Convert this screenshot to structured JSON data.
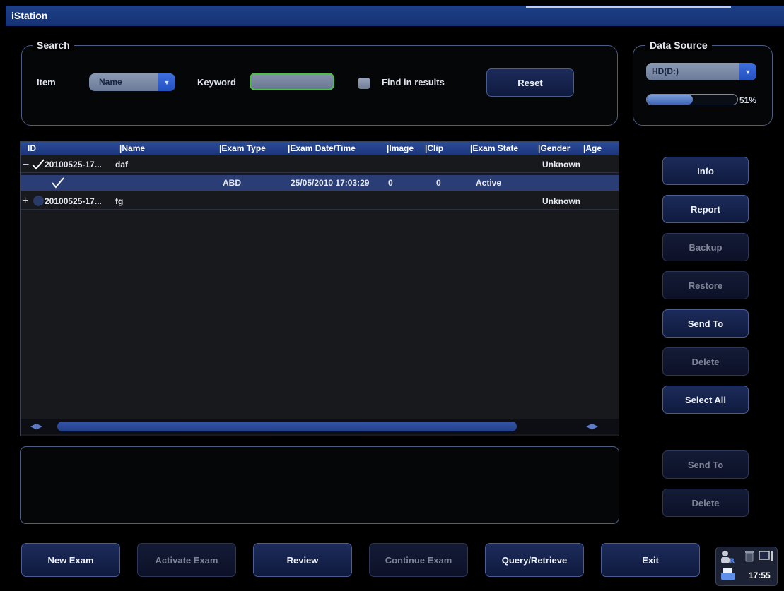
{
  "window": {
    "title": "iStation"
  },
  "search": {
    "group_label": "Search",
    "item_label": "Item",
    "item_value": "Name",
    "keyword_label": "Keyword",
    "keyword_value": "",
    "find_in_results_label": "Find in results",
    "find_in_results_checked": false,
    "reset_label": "Reset"
  },
  "data_source": {
    "group_label": "Data Source",
    "drive": "HD(D:)",
    "usage_percent": 51,
    "usage_text": "51%"
  },
  "table": {
    "columns": [
      "ID",
      "Name",
      "Exam Type",
      "Exam Date/Time",
      "Image",
      "Clip",
      "Exam State",
      "Gender",
      "Age"
    ],
    "rows": [
      {
        "expander": "minus",
        "checked": true,
        "id": "20100525-17...",
        "name": "daf",
        "exam_type": "",
        "exam_datetime": "",
        "image": "",
        "clip": "",
        "exam_state": "",
        "gender": "Unknown",
        "age": ""
      },
      {
        "expander": "",
        "checked": true,
        "id": "",
        "name": "",
        "exam_type": "ABD",
        "exam_datetime": "25/05/2010 17:03:29",
        "image": "0",
        "clip": "0",
        "exam_state": "Active",
        "gender": "",
        "age": ""
      },
      {
        "expander": "plus",
        "checked": false,
        "id": "20100525-17...",
        "name": "fg",
        "exam_type": "",
        "exam_datetime": "",
        "image": "",
        "clip": "",
        "exam_state": "",
        "gender": "Unknown",
        "age": ""
      }
    ]
  },
  "side_buttons": {
    "info": "Info",
    "report": "Report",
    "backup": "Backup",
    "restore": "Restore",
    "send_to": "Send To",
    "delete": "Delete",
    "select_all": "Select All"
  },
  "lower_side_buttons": {
    "send_to": "Send To",
    "delete": "Delete"
  },
  "bottom_buttons": {
    "new_exam": "New Exam",
    "activate_exam": "Activate Exam",
    "review": "Review",
    "continue_exam": "Continue Exam",
    "query_retrieve": "Query/Retrieve",
    "exit": "Exit"
  },
  "tray": {
    "time": "17:55",
    "icons": [
      "user-icon",
      "trash-icon",
      "monitor-icon",
      "printer-icon"
    ]
  },
  "colors": {
    "title_bar": "#1d3f86",
    "header": "#2b4d99",
    "selection": "#2a3d75",
    "accent": "#3f6fe0"
  }
}
